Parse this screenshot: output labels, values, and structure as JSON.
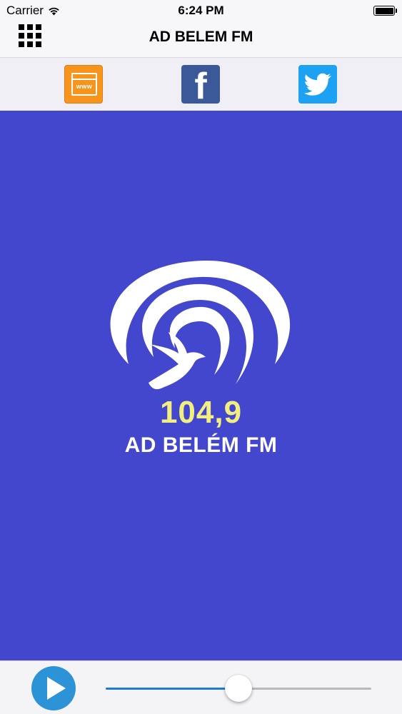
{
  "status_bar": {
    "carrier": "Carrier",
    "time": "6:24 PM",
    "wifi_icon": "wifi-icon",
    "battery_icon": "battery-icon"
  },
  "nav": {
    "title": "AD BELEM FM",
    "menu_icon": "grid-menu-icon"
  },
  "social": {
    "website": {
      "icon": "www-icon",
      "label": "www",
      "color": "#f7941e"
    },
    "facebook": {
      "icon": "facebook-icon",
      "label": "f",
      "color": "#3b5898"
    },
    "twitter": {
      "icon": "twitter-icon",
      "color": "#1da1f2"
    }
  },
  "artwork": {
    "background": "#4347cd",
    "frequency": "104,9",
    "station_name": "AD BELÉM FM",
    "frequency_color": "#f2ee7f"
  },
  "player": {
    "play_icon": "play-icon",
    "volume": 0.5,
    "accent": "#2b93d6"
  }
}
